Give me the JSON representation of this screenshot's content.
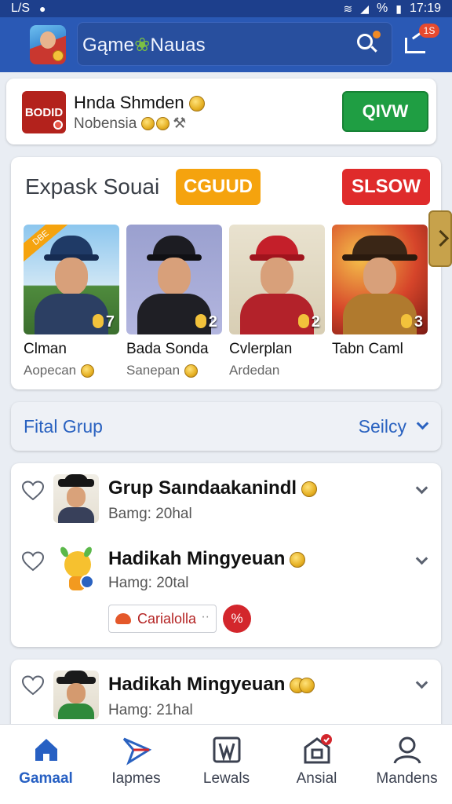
{
  "status_bar": {
    "left_text": "L/S",
    "battery_text": "%",
    "time": "17:19"
  },
  "app_bar": {
    "title": "Gąme",
    "title_suffix": "Nauas",
    "search_icon": "search-icon",
    "share_badge": "1S"
  },
  "promo": {
    "logo_text": "BODID",
    "title": "Hnda Shmden",
    "subtitle": "Nobensia",
    "button": "QIVW"
  },
  "featured": {
    "heading": "Expask Souai",
    "tag_orange": "CGUUD",
    "tag_red": "SLSOW",
    "ribbon": "DBE",
    "players": [
      {
        "name": "Clman",
        "sub": "Aopecan",
        "score": "7"
      },
      {
        "name": "Bada Sonda",
        "sub": "Sanepan",
        "score": "2"
      },
      {
        "name": "Cvlerplan",
        "sub": "Ardedan",
        "score": "2"
      },
      {
        "name": "Tabn Caml",
        "sub": "",
        "score": "3"
      }
    ]
  },
  "filter": {
    "label": "Fital Grup",
    "sort": "Seilcy"
  },
  "groups": [
    {
      "title": "Grup Saındaakanindl",
      "sub": "Bamg: 20hal"
    },
    {
      "title": "Hadikah Mingyeuan",
      "sub": "Hamg: 20tal",
      "chip": "Carialolla",
      "chip_more": "··",
      "badge": "%"
    },
    {
      "title": "Hadikah Mingyeuan",
      "sub": "Hamg: 21hal"
    }
  ],
  "nav": [
    {
      "label": "Gamaal",
      "icon": "home-icon",
      "active": true
    },
    {
      "label": "Iapmes",
      "icon": "send-icon"
    },
    {
      "label": "Lewals",
      "icon": "book-icon"
    },
    {
      "label": "Ansial",
      "icon": "store-icon"
    },
    {
      "label": "Mandens",
      "icon": "user-icon"
    }
  ],
  "colors": {
    "brand": "#2a59b5",
    "accent": "#2760c3",
    "green": "#1f9e43",
    "orange": "#f5a30e",
    "red": "#df2b2b"
  }
}
